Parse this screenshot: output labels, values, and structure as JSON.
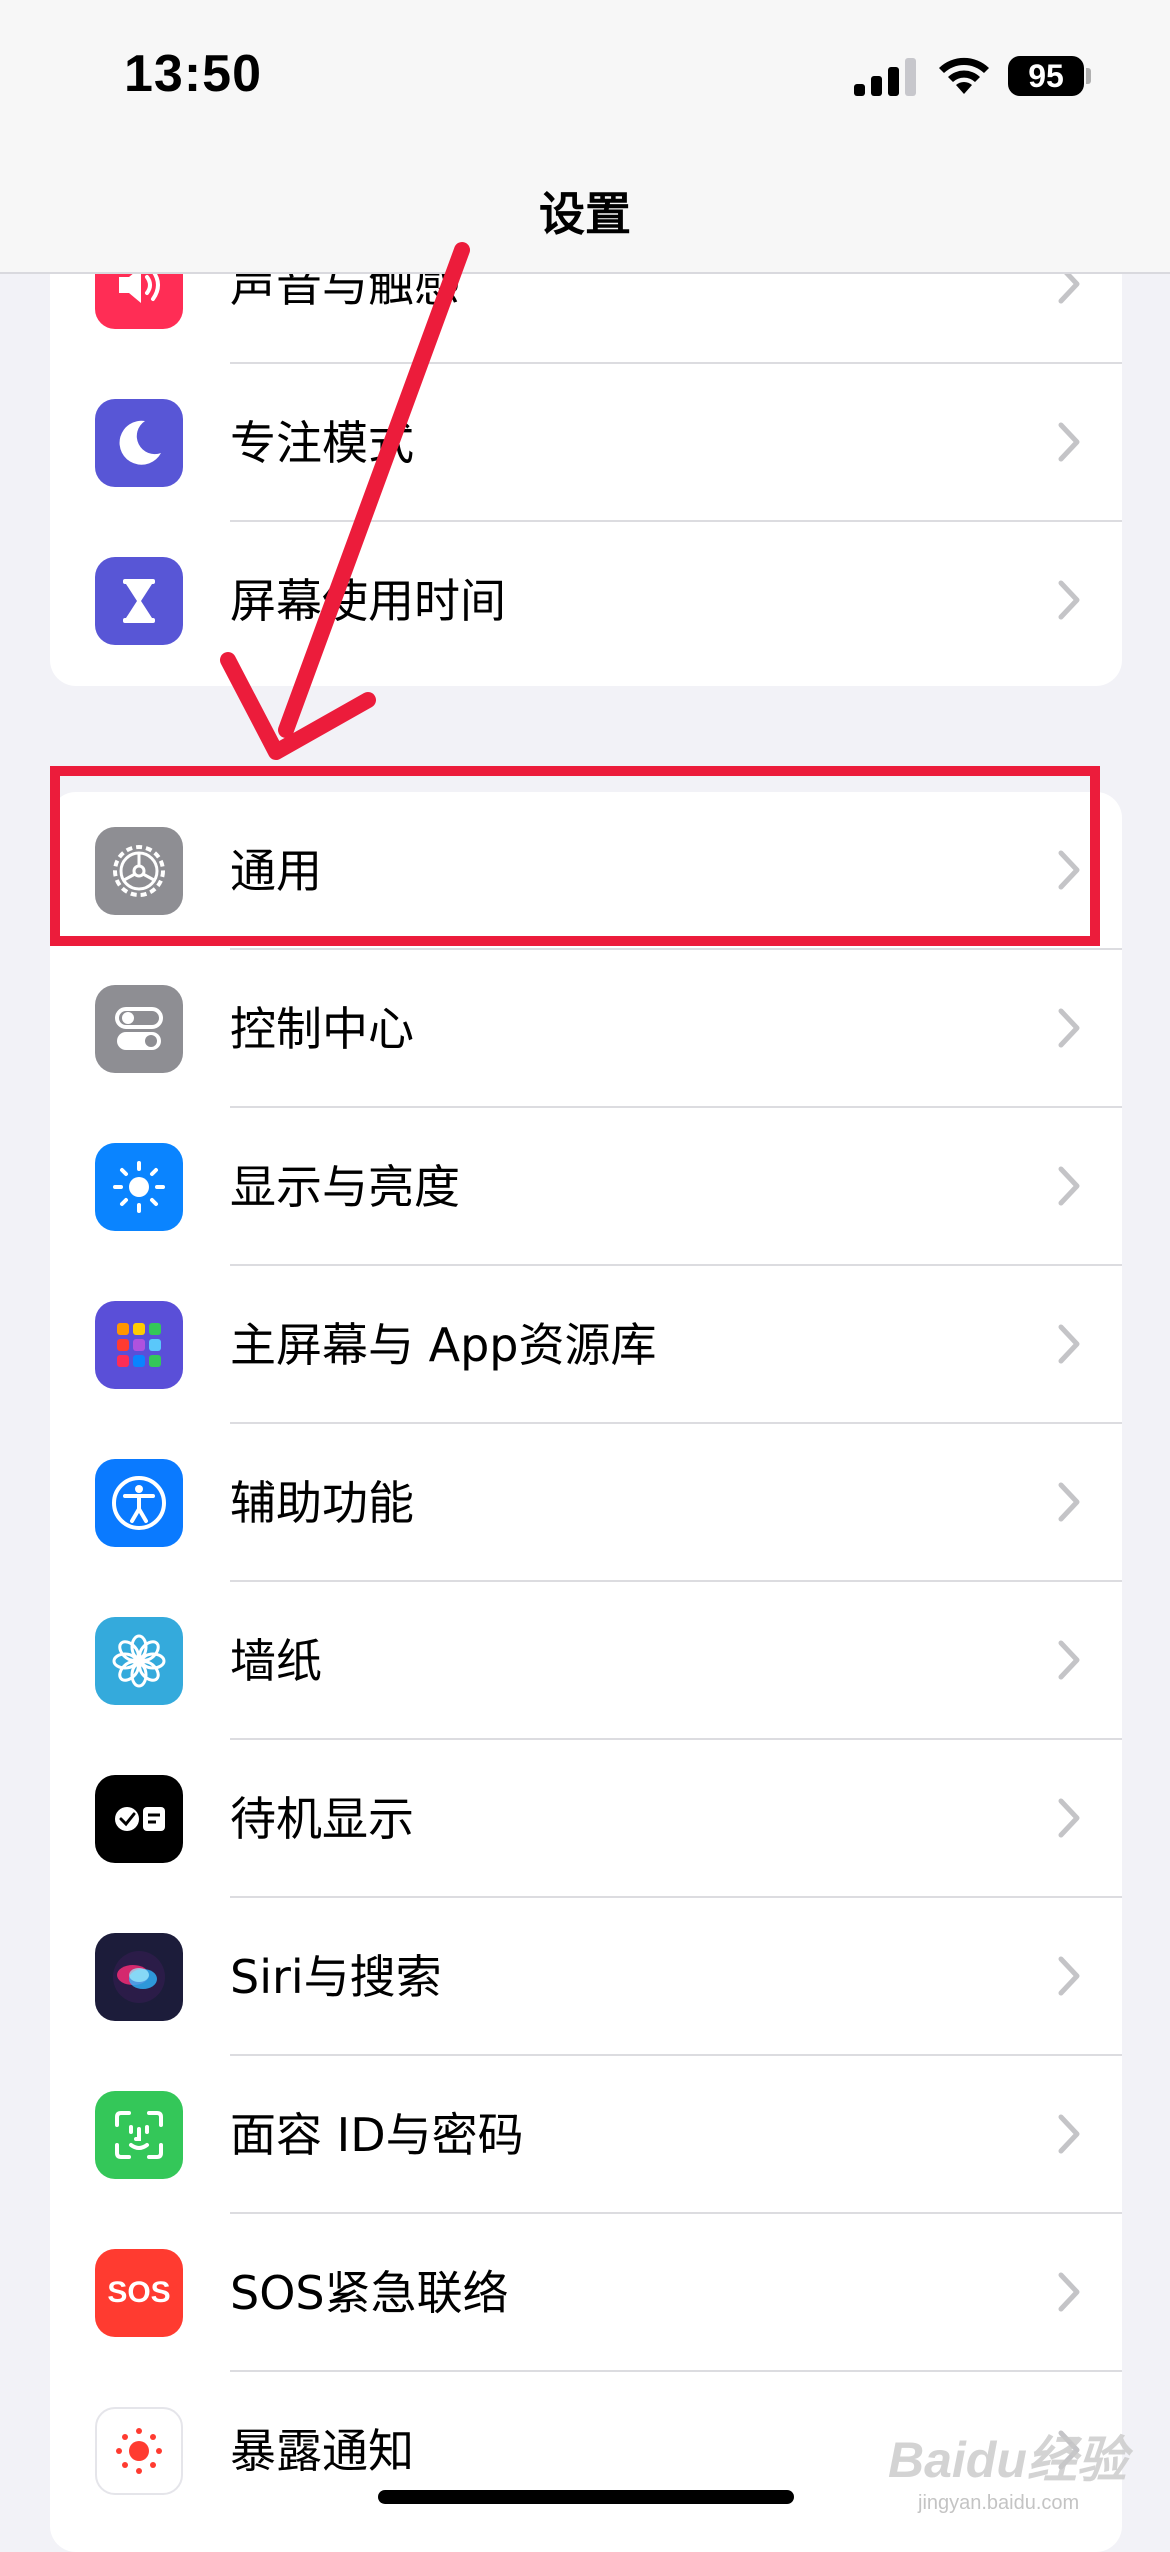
{
  "status_bar": {
    "time": "13:50",
    "battery": "95",
    "icons": [
      "cellular-signal-icon",
      "wifi-icon",
      "battery-icon"
    ]
  },
  "nav": {
    "title": "设置"
  },
  "group_top": [
    {
      "label": "声音与触感",
      "icon": "speaker-icon",
      "color": "#ff2d55"
    },
    {
      "label": "专注模式",
      "icon": "moon-icon",
      "color": "#5856d6"
    },
    {
      "label": "屏幕使用时间",
      "icon": "hourglass-icon",
      "color": "#5856d6"
    }
  ],
  "group_main": [
    {
      "label": "通用",
      "icon": "gear-icon",
      "color": "#8e8e93"
    },
    {
      "label": "控制中心",
      "icon": "toggles-icon",
      "color": "#8e8e93"
    },
    {
      "label": "显示与亮度",
      "icon": "sun-icon",
      "color": "#0a84ff"
    },
    {
      "label": "主屏幕与 App资源库",
      "icon": "app-grid-icon",
      "color": "#5a4fd8"
    },
    {
      "label": "辅助功能",
      "icon": "accessibility-icon",
      "color": "#0a7aff"
    },
    {
      "label": "墙纸",
      "icon": "flower-icon",
      "color": "#34aadc"
    },
    {
      "label": "待机显示",
      "icon": "standby-icon",
      "color": "#000000"
    },
    {
      "label": "Siri与搜索",
      "icon": "siri-icon",
      "color": "#1c1c3a"
    },
    {
      "label": "面容 ID与密码",
      "icon": "face-id-icon",
      "color": "#34c759"
    },
    {
      "label": "SOS紧急联络",
      "icon": "sos-icon",
      "color": "#ff3b30"
    },
    {
      "label": "暴露通知",
      "icon": "exposure-icon",
      "color": "#ffffff"
    }
  ],
  "sos_text": "SOS",
  "annotation": {
    "highlight_color": "#ec1c3b"
  },
  "watermark": {
    "text": "Baidu经验",
    "sub": "jingyan.baidu.com"
  }
}
